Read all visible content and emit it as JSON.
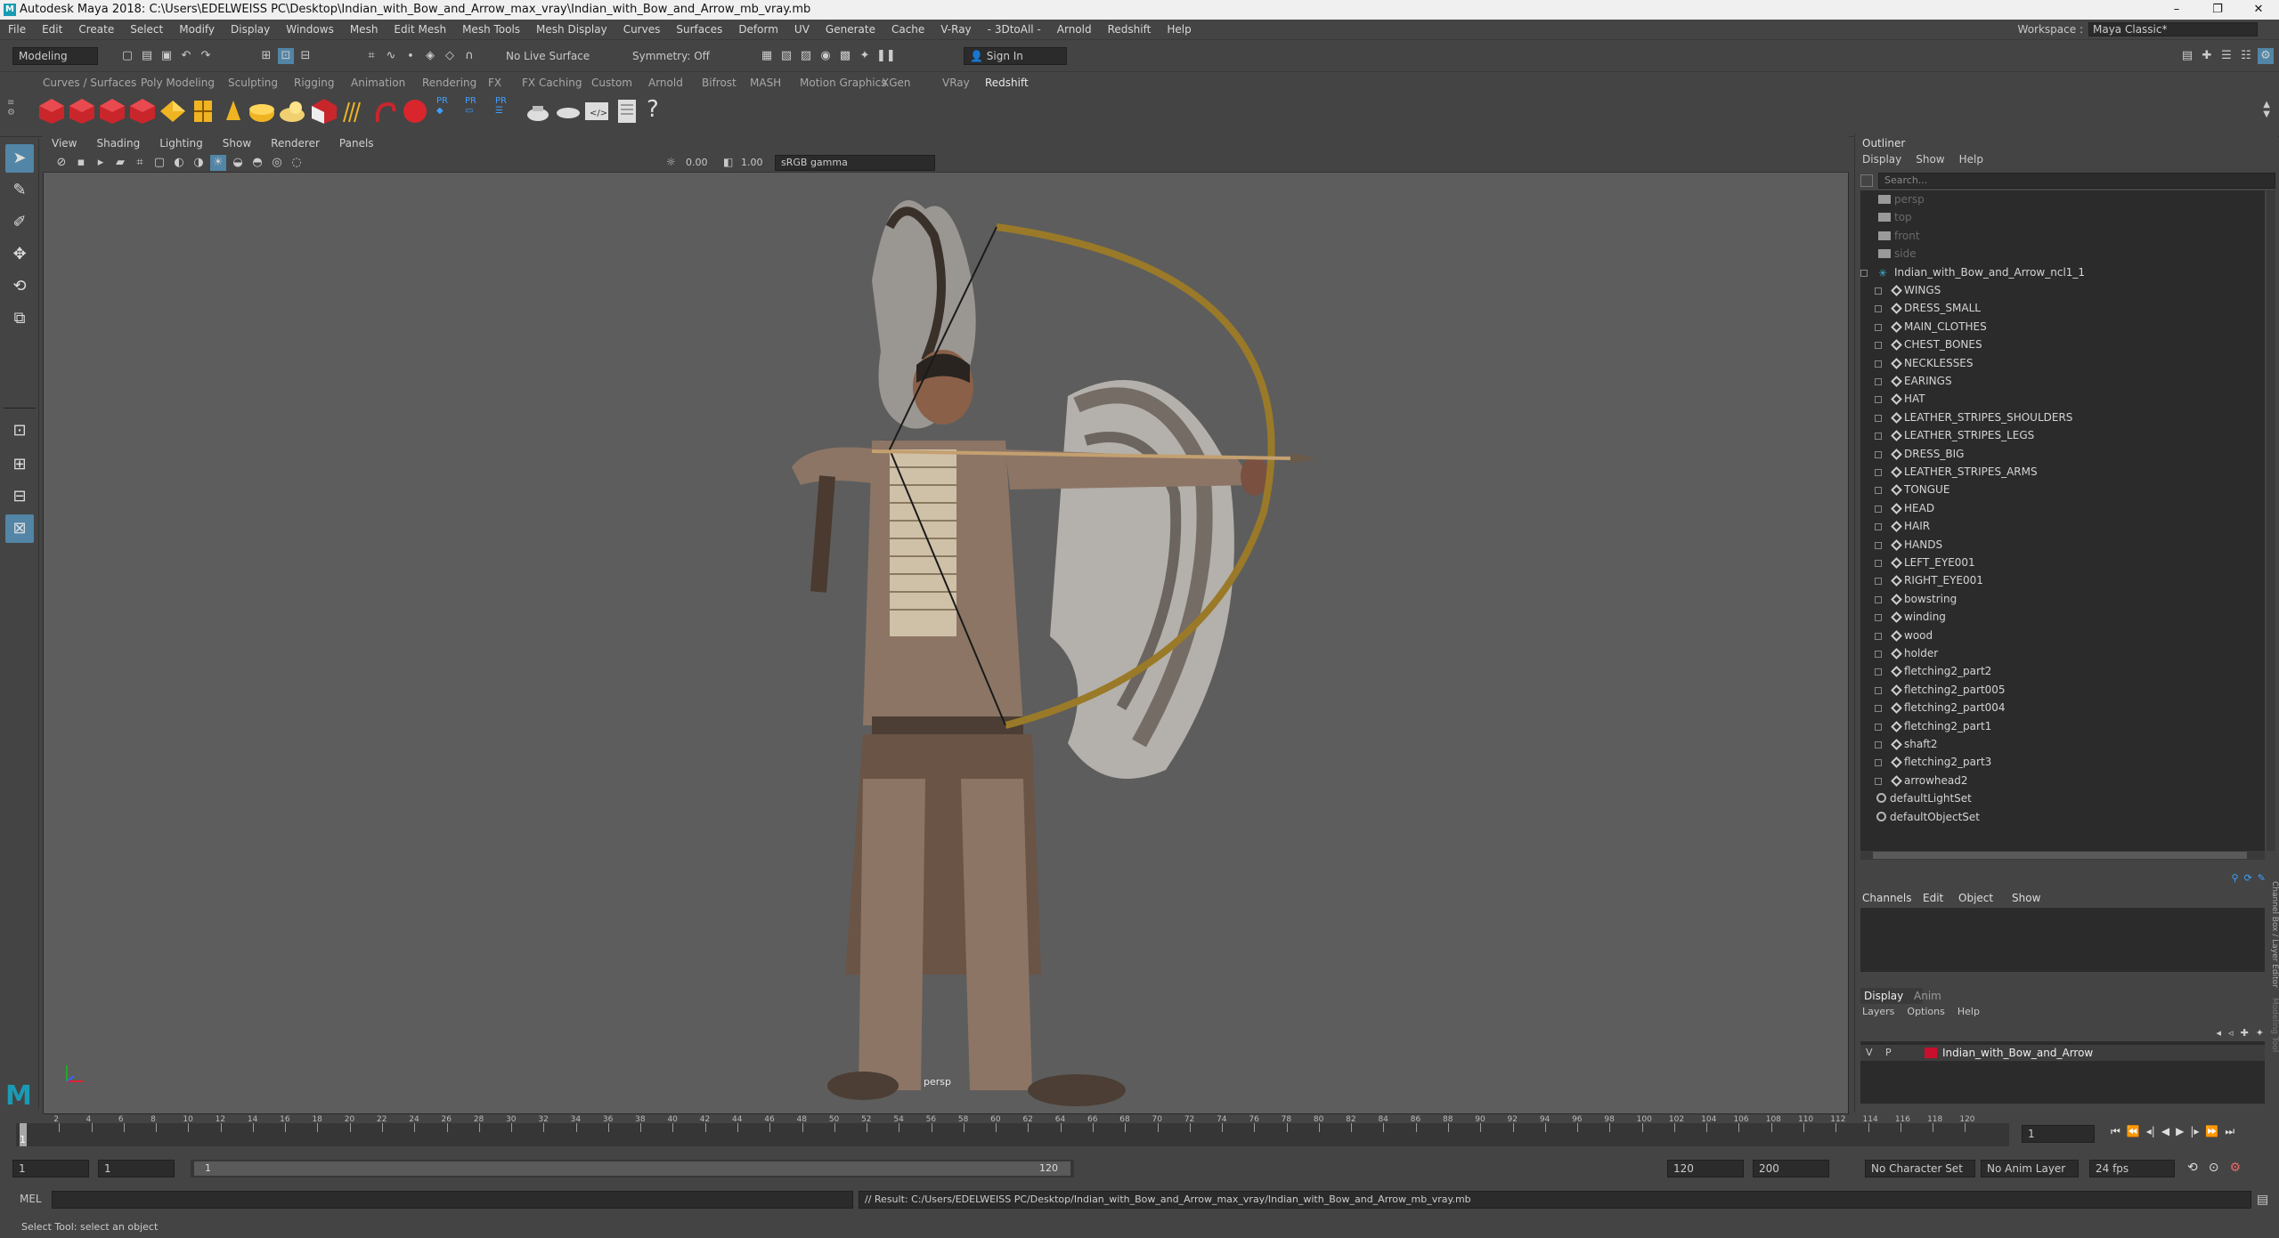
{
  "window": {
    "title": "Autodesk Maya 2018: C:\\Users\\EDELWEISS PC\\Desktop\\Indian_with_Bow_and_Arrow_max_vray\\Indian_with_Bow_and_Arrow_mb_vray.mb",
    "minimize": "–",
    "maximize": "❐",
    "close": "✕"
  },
  "menubar": [
    "File",
    "Edit",
    "Create",
    "Select",
    "Modify",
    "Display",
    "Windows",
    "Mesh",
    "Edit Mesh",
    "Mesh Tools",
    "Mesh Display",
    "Curves",
    "Surfaces",
    "Deform",
    "UV",
    "Generate",
    "Cache",
    "V-Ray",
    "- 3DtoAll -",
    "Arnold",
    "Redshift",
    "Help"
  ],
  "workspace": {
    "label": "Workspace :",
    "value": "Maya Classic*"
  },
  "statusline": {
    "mode": "Modeling",
    "live_surface": "No Live Surface",
    "symmetry": "Symmetry: Off",
    "sign_in": "Sign In"
  },
  "shelf_tabs": [
    "Curves / Surfaces",
    "Poly Modeling",
    "Sculpting",
    "Rigging",
    "Animation",
    "Rendering",
    "FX",
    "FX Caching",
    "Custom",
    "Arnold",
    "Bifrost",
    "MASH",
    "Motion Graphics",
    "XGen",
    "VRay",
    "Redshift"
  ],
  "shelf_active_tab": "Redshift",
  "viewport": {
    "menu": [
      "View",
      "Shading",
      "Lighting",
      "Show",
      "Renderer",
      "Panels"
    ],
    "exposure": "0.00",
    "gamma": "1.00",
    "colorspace": "sRGB gamma",
    "camera_label": "persp"
  },
  "outliner": {
    "title": "Outliner",
    "menu": [
      "Display",
      "Show",
      "Help"
    ],
    "search_placeholder": "Search...",
    "cameras": [
      "persp",
      "top",
      "front",
      "side"
    ],
    "root": "Indian_with_Bow_and_Arrow_ncl1_1",
    "children": [
      "WINGS",
      "DRESS_SMALL",
      "MAIN_CLOTHES",
      "CHEST_BONES",
      "NECKLESSES",
      "EARINGS",
      "HAT",
      "LEATHER_STRIPES_SHOULDERS",
      "LEATHER_STRIPES_LEGS",
      "DRESS_BIG",
      "LEATHER_STRIPES_ARMS",
      "TONGUE",
      "HEAD",
      "HAIR",
      "HANDS",
      "LEFT_EYE001",
      "RIGHT_EYE001",
      "bowstring",
      "winding",
      "wood",
      "holder",
      "fletching2_part2",
      "fletching2_part005",
      "fletching2_part004",
      "fletching2_part1",
      "shaft2",
      "fletching2_part3",
      "arrowhead2"
    ],
    "sets": [
      "defaultLightSet",
      "defaultObjectSet"
    ]
  },
  "channel_box": {
    "menu": [
      "Channels",
      "Edit",
      "Object",
      "Show"
    ],
    "side_tab": "Channel Box / Layer Editor",
    "side_tab2": "Modeling Tool"
  },
  "layer_editor": {
    "tabs": [
      "Display",
      "Anim"
    ],
    "menu": [
      "Layers",
      "Options",
      "Help"
    ],
    "layer": {
      "v": "V",
      "p": "P",
      "name": "Indian_with_Bow_and_Arrow",
      "color": "#c8102e"
    }
  },
  "timeline": {
    "ticks": [
      "2",
      "4",
      "6",
      "8",
      "10",
      "12",
      "14",
      "16",
      "18",
      "20",
      "22",
      "24",
      "26",
      "28",
      "30",
      "32",
      "34",
      "36",
      "38",
      "40",
      "42",
      "44",
      "46",
      "48",
      "50",
      "52",
      "54",
      "56",
      "58",
      "60",
      "62",
      "64",
      "66",
      "68",
      "70",
      "72",
      "74",
      "76",
      "78",
      "80",
      "82",
      "84",
      "86",
      "88",
      "90",
      "92",
      "94",
      "96",
      "98",
      "100",
      "102",
      "104",
      "106",
      "108",
      "110",
      "112",
      "114",
      "116",
      "118",
      "120"
    ],
    "current_frame": "1",
    "current_marker": "1"
  },
  "range": {
    "start": "1",
    "anim_start": "1",
    "range_label": "1",
    "range_end_label": "120",
    "end": "120",
    "anim_end": "200",
    "character_set": "No Character Set",
    "anim_layer": "No Anim Layer",
    "fps": "24 fps"
  },
  "mel": {
    "label": "MEL",
    "result": "// Result: C:/Users/EDELWEISS PC/Desktop/Indian_with_Bow_and_Arrow_max_vray/Indian_with_Bow_and_Arrow_mb_vray.mb"
  },
  "help_line": "Select Tool: select an object"
}
